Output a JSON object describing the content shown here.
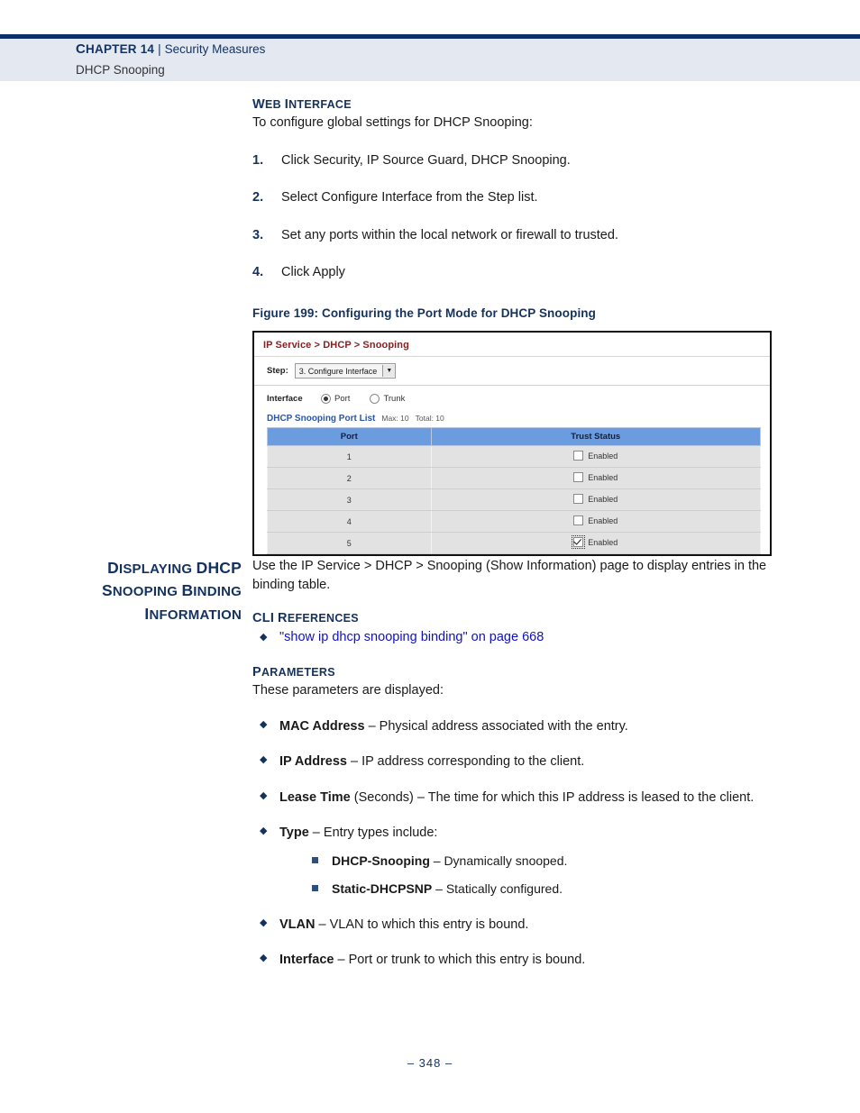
{
  "header": {
    "chapter_label": "Chapter 14",
    "separator": "|",
    "section": "Security Measures",
    "subsection": "DHCP Snooping",
    "rule_color": "#0b2f6b",
    "band_color": "#e3e8f1"
  },
  "web_interface": {
    "heading": "Web Interface",
    "intro": "To configure global settings for DHCP Snooping:",
    "steps": [
      {
        "num": "1.",
        "text": "Click Security, IP Source Guard, DHCP Snooping."
      },
      {
        "num": "2.",
        "text": "Select Configure Interface from the Step list."
      },
      {
        "num": "3.",
        "text": "Set any ports within the local network or firewall to trusted."
      },
      {
        "num": "4.",
        "text": "Click Apply"
      }
    ]
  },
  "figure": {
    "caption": "Figure 199:  Configuring the Port Mode for DHCP Snooping",
    "breadcrumb": "IP Service > DHCP > Snooping",
    "step_label": "Step:",
    "step_value": "3. Configure Interface",
    "interface_label": "Interface",
    "radios": [
      {
        "label": "Port",
        "checked": true
      },
      {
        "label": "Trunk",
        "checked": false
      }
    ],
    "list_title": "DHCP Snooping Port List",
    "list_max": "Max: 10",
    "list_total": "Total: 10",
    "columns": [
      "Port",
      "Trust Status"
    ],
    "rows": [
      {
        "port": "1",
        "trust_label": "Enabled",
        "checked": false,
        "focused": false
      },
      {
        "port": "2",
        "trust_label": "Enabled",
        "checked": false,
        "focused": false
      },
      {
        "port": "3",
        "trust_label": "Enabled",
        "checked": false,
        "focused": false
      },
      {
        "port": "4",
        "trust_label": "Enabled",
        "checked": false,
        "focused": false
      },
      {
        "port": "5",
        "trust_label": "Enabled",
        "checked": true,
        "focused": true
      }
    ],
    "header_color": "#6b9ce0",
    "breadcrumb_color": "#8b1f1f"
  },
  "binding_section": {
    "side_heading_line1": "Displaying DHCP",
    "side_heading_line2": "Snooping Binding",
    "side_heading_line3": "Information",
    "intro": "Use the IP Service > DHCP > Snooping (Show Information) page to display entries in the binding table.",
    "cli_heading": "CLI References",
    "cli_link": "\"show ip dhcp snooping binding\" on page 668",
    "cli_link_color": "#0f10c8",
    "parameters_heading": "Parameters",
    "parameters_intro": "These parameters are displayed:",
    "parameters": [
      {
        "term": "MAC Address",
        "desc": " – Physical address associated with the entry."
      },
      {
        "term": "IP Address",
        "desc": " – IP address corresponding to the client."
      },
      {
        "term": "Lease Time",
        "desc": " (Seconds) – The time for which this IP address is leased to the client."
      },
      {
        "term": "Type",
        "desc": " – Entry types include:"
      },
      {
        "term": "VLAN",
        "desc": " – VLAN to which this entry is bound."
      },
      {
        "term": "Interface",
        "desc": " – Port or trunk to which this entry is bound."
      }
    ],
    "type_subitems": [
      {
        "term": "DHCP-Snooping",
        "desc": " – Dynamically snooped."
      },
      {
        "term": "Static-DHCPSNP",
        "desc": " – Statically configured."
      }
    ]
  },
  "footer": {
    "page_number": "–  348  –"
  }
}
